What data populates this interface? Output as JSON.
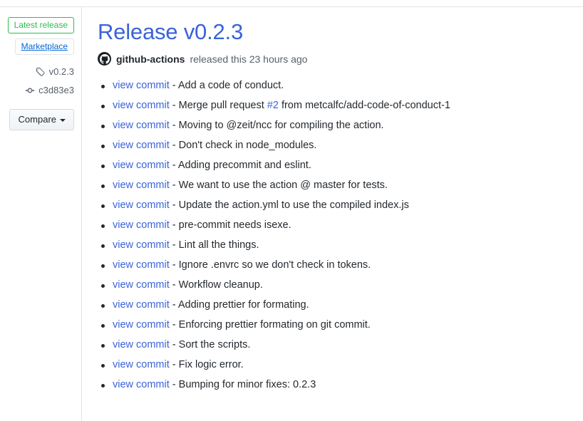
{
  "sidebar": {
    "latest_release_badge": "Latest release",
    "marketplace_badge": "Marketplace",
    "tag_icon": "tag-icon",
    "tag_name": "v0.2.3",
    "commit_icon": "git-commit-icon",
    "commit_sha": "c3d83e3",
    "compare_label": "Compare"
  },
  "main": {
    "title": "Release v0.2.3",
    "avatar_icon": "github-logo-icon",
    "author": "github-actions",
    "released_text": "released this 23 hours ago",
    "commit_link_label": "view commit",
    "separator": " - ",
    "commits": [
      {
        "message": "Add a code of conduct."
      },
      {
        "message_before": "Merge pull request ",
        "issue": "#2",
        "message_after": " from metcalfc/add-code-of-conduct-1"
      },
      {
        "message": "Moving to @zeit/ncc for compiling the action."
      },
      {
        "message": "Don't check in node_modules."
      },
      {
        "message": "Adding precommit and eslint."
      },
      {
        "message": "We want to use the action @ master for tests."
      },
      {
        "message": "Update the action.yml to use the compiled index.js"
      },
      {
        "message": "pre-commit needs isexe."
      },
      {
        "message": "Lint all the things."
      },
      {
        "message": "Ignore .envrc so we don't check in tokens."
      },
      {
        "message": "Workflow cleanup."
      },
      {
        "message": "Adding prettier for formating."
      },
      {
        "message": "Enforcing prettier formating on git commit."
      },
      {
        "message": "Sort the scripts."
      },
      {
        "message": "Fix logic error."
      },
      {
        "message": "Bumping for minor fixes: 0.2.3"
      }
    ]
  },
  "colors": {
    "link": "#3a63d8",
    "latest_release_green": "#2cbe4e",
    "marketplace_blue": "#0366d6",
    "muted_text": "#586069",
    "border": "#e1e4e8"
  }
}
